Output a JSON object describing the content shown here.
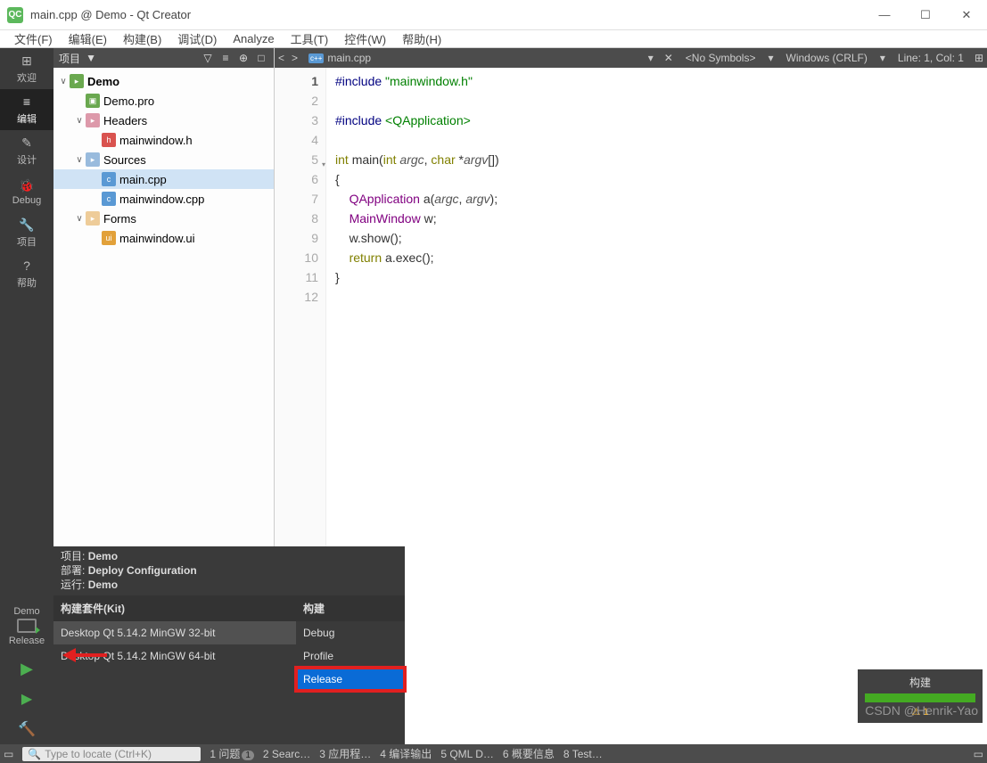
{
  "window": {
    "title": "main.cpp @ Demo - Qt Creator",
    "app_icon": "QC"
  },
  "menus": [
    "文件(F)",
    "编辑(E)",
    "构建(B)",
    "调试(D)",
    "Analyze",
    "工具(T)",
    "控件(W)",
    "帮助(H)"
  ],
  "rail": {
    "items": [
      {
        "label": "欢迎",
        "icon": "⊞"
      },
      {
        "label": "编辑",
        "icon": "≡",
        "active": true
      },
      {
        "label": "设计",
        "icon": "✎"
      },
      {
        "label": "Debug",
        "icon": "🐞"
      },
      {
        "label": "项目",
        "icon": "🔧"
      },
      {
        "label": "帮助",
        "icon": "?"
      }
    ],
    "target": {
      "project": "Demo",
      "config": "Release"
    },
    "run_icons": [
      "play",
      "play-debug",
      "build"
    ]
  },
  "project_panel": {
    "title": "项目",
    "buttons": [
      "▼",
      "▽",
      "≡",
      "⊕",
      "□"
    ],
    "tree": [
      {
        "indent": 0,
        "chev": "∨",
        "icon": "folder-qt",
        "label": "Demo",
        "bold": true
      },
      {
        "indent": 1,
        "chev": "",
        "icon": "pro",
        "label": "Demo.pro"
      },
      {
        "indent": 1,
        "chev": "∨",
        "icon": "folder-h",
        "label": "Headers"
      },
      {
        "indent": 2,
        "chev": "",
        "icon": "h",
        "label": "mainwindow.h"
      },
      {
        "indent": 1,
        "chev": "∨",
        "icon": "folder-c",
        "label": "Sources"
      },
      {
        "indent": 2,
        "chev": "",
        "icon": "cpp",
        "label": "main.cpp",
        "selected": true
      },
      {
        "indent": 2,
        "chev": "",
        "icon": "cpp",
        "label": "mainwindow.cpp"
      },
      {
        "indent": 1,
        "chev": "∨",
        "icon": "folder-f",
        "label": "Forms"
      },
      {
        "indent": 2,
        "chev": "",
        "icon": "ui",
        "label": "mainwindow.ui"
      }
    ]
  },
  "editor": {
    "nav": {
      "back": "<",
      "fwd": ">"
    },
    "file_icon": "cpp",
    "filename": "main.cpp",
    "symbols": "<No Symbols>",
    "encoding": "Windows (CRLF)",
    "position": "Line: 1, Col: 1",
    "lines": 12
  },
  "code": {
    "l1": {
      "a": "#include",
      "b": "\"mainwindow.h\""
    },
    "l3": {
      "a": "#include",
      "b": "<QApplication>"
    },
    "l5": {
      "int": "int",
      "main": "main",
      "p1": "(",
      "intk": "int",
      "argc": "argc",
      "c": ",",
      "chark": "char",
      "star": "*",
      "argv": "argv",
      "br": "[])"
    },
    "l6": "{",
    "l7": {
      "sp": "    ",
      "type": "QApplication",
      "a": " a(",
      "argc": "argc",
      "c": ", ",
      "argv": "argv",
      "e": ");"
    },
    "l8": {
      "sp": "    ",
      "type": "MainWindow",
      "w": " w;"
    },
    "l9": {
      "sp": "    ",
      "w": "w",
      "dot": ".",
      "fn": "show",
      "p": "();"
    },
    "l10": {
      "sp": "    ",
      "ret": "return",
      "a": " a.",
      "fn": "exec",
      "p": "();"
    },
    "l11": "}"
  },
  "popup": {
    "rows": [
      {
        "k": "项目",
        "v": "Demo"
      },
      {
        "k": "部署",
        "v": "Deploy Configuration"
      },
      {
        "k": "运行",
        "v": "Demo"
      }
    ],
    "head_kit": "构建套件(Kit)",
    "head_build": "构建",
    "kits": [
      "Desktop Qt 5.14.2 MinGW 32-bit",
      "Desktop Qt 5.14.2 MinGW 64-bit"
    ],
    "builds": [
      "Debug",
      "Profile",
      "Release"
    ]
  },
  "toast": {
    "title": "构建",
    "warn": "⚠ 1"
  },
  "statusbar": {
    "locator_icon": "🔍",
    "locator": "Type to locate (Ctrl+K)",
    "items": [
      "1 问题",
      "2 Searc…",
      "3 应用程…",
      "4 编译输出",
      "5 QML D…",
      "6 概要信息",
      "8 Test…"
    ],
    "issues_badge": "1"
  },
  "watermark": "CSDN @Henrik-Yao"
}
